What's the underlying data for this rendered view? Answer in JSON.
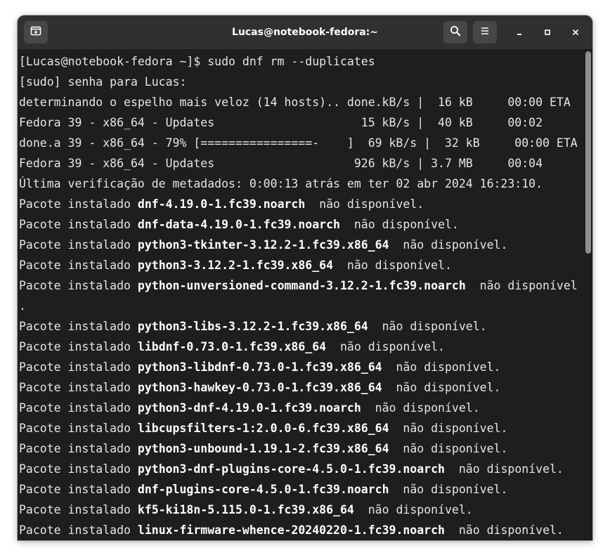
{
  "window": {
    "title": "Lucas@notebook-fedora:~"
  },
  "icons": {
    "new_tab": "new-tab-icon",
    "search": "search-icon",
    "menu": "hamburger-menu-icon",
    "minimize": "minimize-icon",
    "maximize": "maximize-icon",
    "close": "close-icon"
  },
  "colors": {
    "terminal_bg": "#1e1e1e",
    "headerbar_bg": "#303030",
    "text": "#e6e6e6"
  },
  "terminal": {
    "prompt": "[Lucas@notebook-fedora ~]$ sudo dnf rm --duplicates",
    "sudo_prompt": "[sudo] senha para Lucas:",
    "progress_lines": [
      "determinando o espelho mais veloz (14 hosts).. done.kB/s |  16 kB     00:00 ETA",
      "Fedora 39 - x86_64 - Updates                     15 kB/s |  40 kB     00:02",
      "done.a 39 - x86_64 - 79% [================-    ]  69 kB/s |  32 kB     00:00 ETA",
      "Fedora 39 - x86_64 - Updates                    926 kB/s | 3.7 MB     00:04"
    ],
    "metadata_line": "Última verificação de metadados: 0:00:13 atrás em ter 02 abr 2024 16:23:10.",
    "pkg_prefix": "Pacote instalado ",
    "pkg_status": "não disponível.",
    "packages": [
      {
        "name": "dnf-4.19.0-1.fc39.noarch",
        "status": "não disponível."
      },
      {
        "name": "dnf-data-4.19.0-1.fc39.noarch",
        "status": "não disponível."
      },
      {
        "name": "python3-tkinter-3.12.2-1.fc39.x86_64",
        "status": "não disponível."
      },
      {
        "name": "python3-3.12.2-1.fc39.x86_64",
        "status": "não disponível."
      },
      {
        "name": "python-unversioned-command-3.12.2-1.fc39.noarch",
        "status": "não disponível",
        "wrap": "."
      },
      {
        "name": "python3-libs-3.12.2-1.fc39.x86_64",
        "status": "não disponível."
      },
      {
        "name": "libdnf-0.73.0-1.fc39.x86_64",
        "status": "não disponível."
      },
      {
        "name": "python3-libdnf-0.73.0-1.fc39.x86_64",
        "status": "não disponível."
      },
      {
        "name": "python3-hawkey-0.73.0-1.fc39.x86_64",
        "status": "não disponível."
      },
      {
        "name": "python3-dnf-4.19.0-1.fc39.noarch",
        "status": "não disponível."
      },
      {
        "name": "libcupsfilters-1:2.0.0-6.fc39.x86_64",
        "status": "não disponível."
      },
      {
        "name": "python3-unbound-1.19.1-2.fc39.x86_64",
        "status": "não disponível."
      },
      {
        "name": "python3-dnf-plugins-core-4.5.0-1.fc39.noarch",
        "status": "não disponível."
      },
      {
        "name": "dnf-plugins-core-4.5.0-1.fc39.noarch",
        "status": "não disponível."
      },
      {
        "name": "kf5-ki18n-5.115.0-1.fc39.x86_64",
        "status": "não disponível."
      },
      {
        "name": "linux-firmware-whence-20240220-1.fc39.noarch",
        "status": "não disponível."
      }
    ]
  }
}
